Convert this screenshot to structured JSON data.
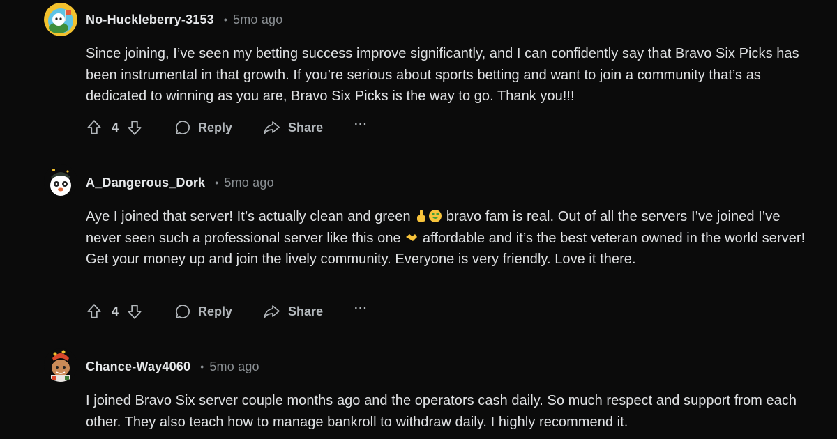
{
  "comments": [
    {
      "username": "No-Huckleberry-3153",
      "time": "5mo ago",
      "body": "Since joining, I’ve seen my betting success improve significantly, and I can confidently say that Bravo Six Picks has been instrumental in that growth. If you’re serious about sports betting and want to join a community that’s as dedicated to winning as you are, Bravo Six Picks is the way to go. Thank you!!!",
      "votes": "4",
      "reply_label": "Reply",
      "share_label": "Share",
      "more_label": "···"
    },
    {
      "username": "A_Dangerous_Dork",
      "time": "5mo ago",
      "body_part1": "Aye I joined that server! It’s actually clean and green ",
      "body_part2": " bravo fam is real. Out of all the servers I’ve joined I’ve never seen such a professional server like this one ",
      "body_part3": " affordable and it’s the best veteran owned in the world server! Get your money up and join the lively community. Everyone is very friendly. Love it there.",
      "emojis": [
        "pointing-up-icon",
        "money-mouth-face-icon",
        "handshake-icon"
      ],
      "votes": "4",
      "reply_label": "Reply",
      "share_label": "Share",
      "more_label": "···"
    },
    {
      "username": "Chance-Way4060",
      "time": "5mo ago",
      "body": "I joined Bravo Six server couple months ago and the operators cash daily. So much respect and support from each other. They also teach how to manage bankroll to withdraw daily. I highly recommend it."
    }
  ],
  "colors": {
    "background": "#0b0b0b",
    "text": "#dfe1e3",
    "muted": "#8a8f93",
    "action": "#b3b8bc"
  }
}
